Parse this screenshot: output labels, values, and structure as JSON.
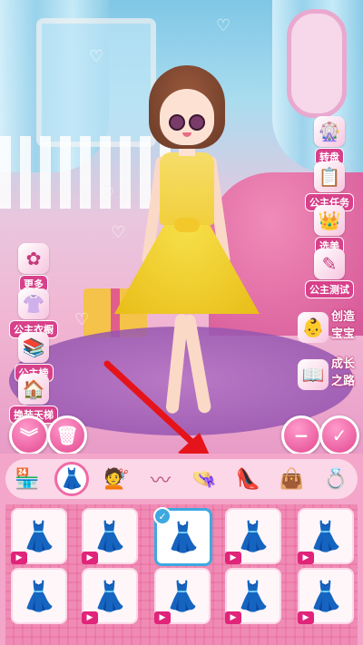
{
  "left_menu": [
    {
      "icon": "more-icon",
      "label": "更多"
    },
    {
      "icon": "princess-wardrobe-icon",
      "label": "公主衣橱"
    },
    {
      "icon": "princess-ranking-icon",
      "label": "公主榜"
    },
    {
      "icon": "change-background-icon",
      "label": "换装天梯"
    }
  ],
  "right_menu": [
    {
      "icon": "turntable-icon",
      "label": "转盘"
    },
    {
      "icon": "princess-task-icon",
      "label": "公主任务"
    },
    {
      "icon": "vote-beauty-icon",
      "label": "选美"
    },
    {
      "icon": "princess-test-icon",
      "label": "公主测试"
    }
  ],
  "create_baby": {
    "line1": "创造",
    "line2": "宝宝"
  },
  "growth_path": {
    "line1": "成长",
    "line2": "之路"
  },
  "action_buttons": {
    "collapse": "collapse-chevrons-icon",
    "delete": "trash-icon",
    "remove": "minus-icon",
    "confirm": "check-icon"
  },
  "category_tabs": [
    {
      "name": "shop",
      "glyph": "🏪"
    },
    {
      "name": "dress",
      "glyph": "👗"
    },
    {
      "name": "hair",
      "glyph": "💇"
    },
    {
      "name": "eyebrow",
      "glyph": "〰"
    },
    {
      "name": "hat",
      "glyph": "👒"
    },
    {
      "name": "shoes",
      "glyph": "👠"
    },
    {
      "name": "bag",
      "glyph": "👜"
    },
    {
      "name": "accessory",
      "glyph": "💍"
    }
  ],
  "active_tab": "dress",
  "items": [
    {
      "glyph": "👗",
      "color": "#7fb6e8",
      "video": true,
      "selected": false
    },
    {
      "glyph": "👗",
      "color": "#c9284a",
      "video": true,
      "selected": false
    },
    {
      "glyph": "👗",
      "color": "#f1cf3c",
      "video": false,
      "selected": true
    },
    {
      "glyph": "👗",
      "color": "#e8e8f2",
      "video": true,
      "selected": false
    },
    {
      "glyph": "👗",
      "color": "#5e3a8c",
      "video": true,
      "selected": false
    },
    {
      "glyph": "👗",
      "color": "#6ab6e8",
      "video": false,
      "selected": false
    },
    {
      "glyph": "👗",
      "color": "#e8a0b4",
      "video": true,
      "selected": false
    },
    {
      "glyph": "👗",
      "color": "#7cc04a",
      "video": true,
      "selected": false
    },
    {
      "glyph": "👗",
      "color": "#c8b8ec",
      "video": true,
      "selected": false
    },
    {
      "glyph": "👗",
      "color": "#e070a8",
      "video": true,
      "selected": false
    }
  ]
}
